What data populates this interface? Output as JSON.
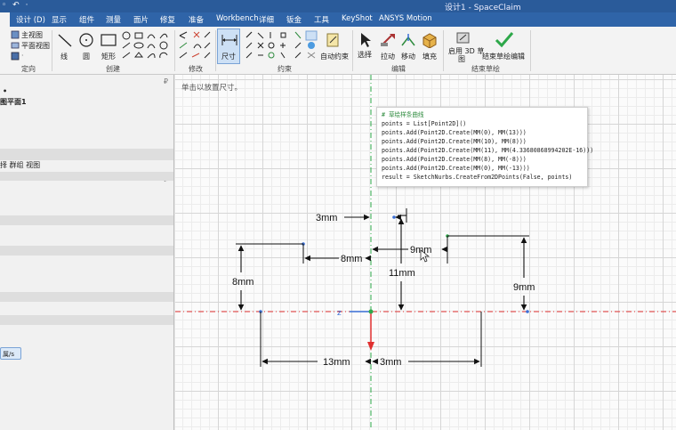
{
  "titlebar": {
    "quick_access": "◦ ↶ ·",
    "title": "设计1 - SpaceClaim"
  },
  "menu": {
    "tabs": [
      "设计 (D)",
      "显示",
      "组件",
      "测量",
      "面片",
      "修复",
      "准备",
      "Workbench",
      "详细",
      "钣金",
      "工具",
      "KeyShot",
      "ANSYS Motion"
    ]
  },
  "ribbon": {
    "orient": {
      "items": [
        "主视图",
        "平面视图",
        "·"
      ],
      "label": "定向"
    },
    "create": {
      "line": "线",
      "circle": "圆",
      "rect": "矩形",
      "label": "创建"
    },
    "modify": {
      "label": "修改"
    },
    "constrain": {
      "dimension": "尺寸",
      "auto": "自动约束",
      "label": "约束"
    },
    "edit": {
      "select": "选择",
      "pull": "拉动",
      "move": "移动",
      "fill": "填充",
      "label": "编辑"
    },
    "finish": {
      "enable3d_line1": "启用 3D 草",
      "enable3d_line2": "图",
      "finish_edit": "结束草绘编辑",
      "label": "结束草绘"
    }
  },
  "leftpanel": {
    "dot": "•",
    "sketch_plane": "图平面1",
    "tabs_row": "择   群组   视图",
    "pin": "₽",
    "bottom_button": "属/s"
  },
  "canvas": {
    "hint": "单击以放置尺寸。",
    "code_lines": [
      "# 草绘样条曲线",
      "points = List[Point2D]()",
      "points.Add(Point2D.Create(MM(0), MM(13)))",
      "points.Add(Point2D.Create(MM(10), MM(8)))",
      "points.Add(Point2D.Create(MM(11), MM(4.33680868994202E-16)))",
      "points.Add(Point2D.Create(MM(8), MM(-8)))",
      "points.Add(Point2D.Create(MM(0), MM(-13)))",
      "result = SketchNurbs.CreateFrom2DPoints(False, points)"
    ],
    "dims": {
      "d3a": "3mm",
      "d8a": "8mm",
      "d9a": "9mm",
      "d11": "11mm",
      "d8b": "8mm",
      "d9b": "9mm",
      "d13": "13mm",
      "d3b": "3mm"
    },
    "axis_label": "z",
    "colors": {
      "axis_red": "#e03030",
      "axis_green": "#2ea84a",
      "point_blue": "#3a6fd6",
      "accent": "#2f64a8"
    }
  }
}
